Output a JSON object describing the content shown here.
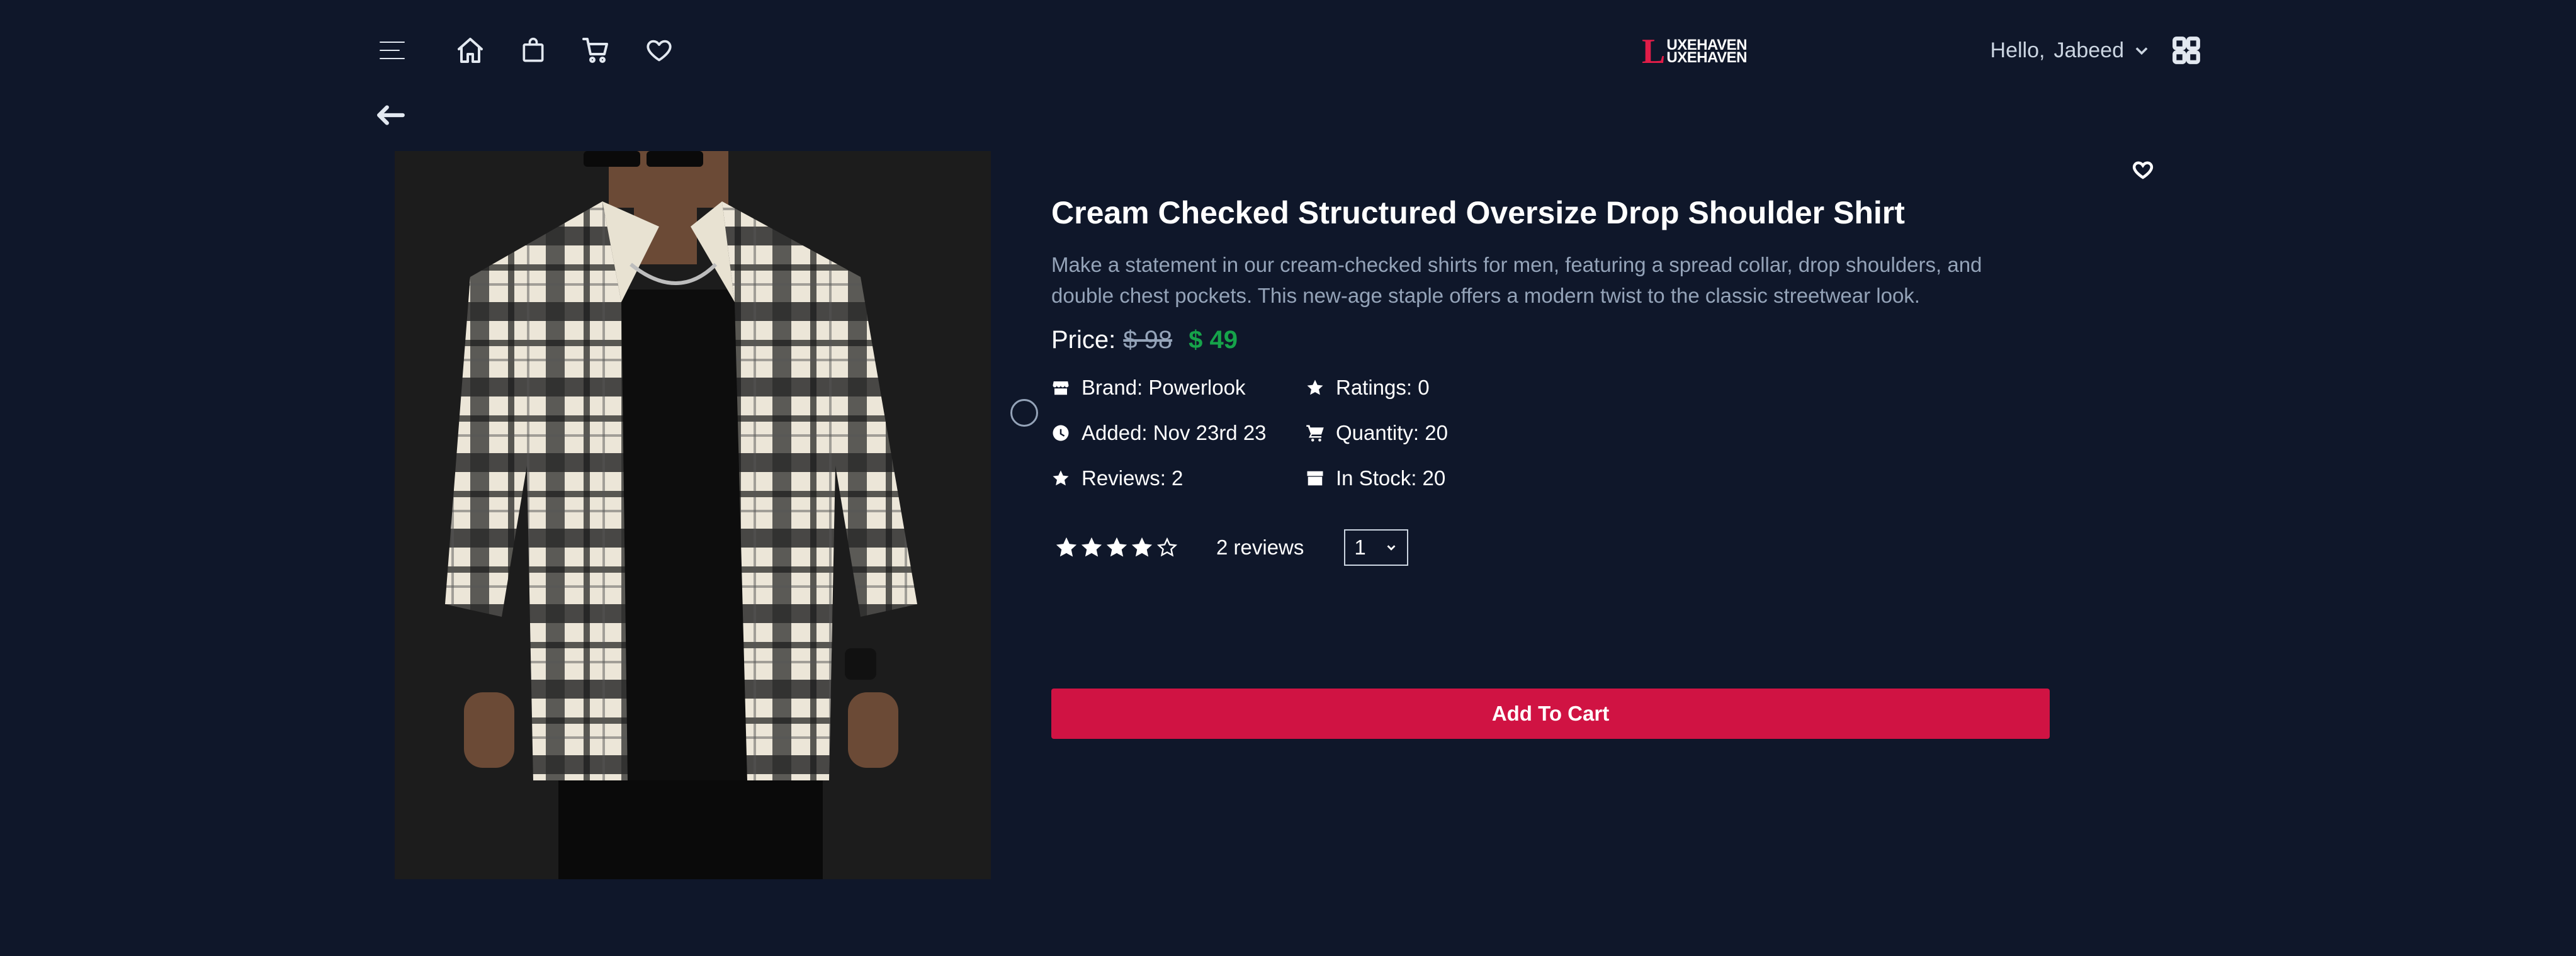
{
  "header": {
    "logo_letter": "L",
    "logo_line1": "UXEHAVEN",
    "logo_line2": "UXEHAVEN",
    "greeting": "Hello,",
    "user_name": "Jabeed"
  },
  "product": {
    "title": "Cream Checked Structured Oversize Drop Shoulder Shirt",
    "description": "Make a statement in our cream-checked shirts for men, featuring a spread collar, drop shoulders, and double chest pockets. This new-age staple offers a modern twist to the classic streetwear look.",
    "price_label": "Price:",
    "old_price": "$ 98",
    "new_price": "$ 49",
    "info": {
      "brand": "Brand: Powerlook",
      "ratings": "Ratings: 0",
      "added": "Added: Nov 23rd 23",
      "quantity": "Quantity: 20",
      "reviews": "Reviews: 2",
      "in_stock": "In Stock: 20"
    },
    "star_rating": 4,
    "star_max": 5,
    "review_count": "2 reviews",
    "qty_selected": "1",
    "add_to_cart": "Add To Cart"
  },
  "colors": {
    "background": "#0f172a",
    "accent": "#d01343",
    "price_new": "#16a34a",
    "muted_text": "#94a3b8"
  }
}
